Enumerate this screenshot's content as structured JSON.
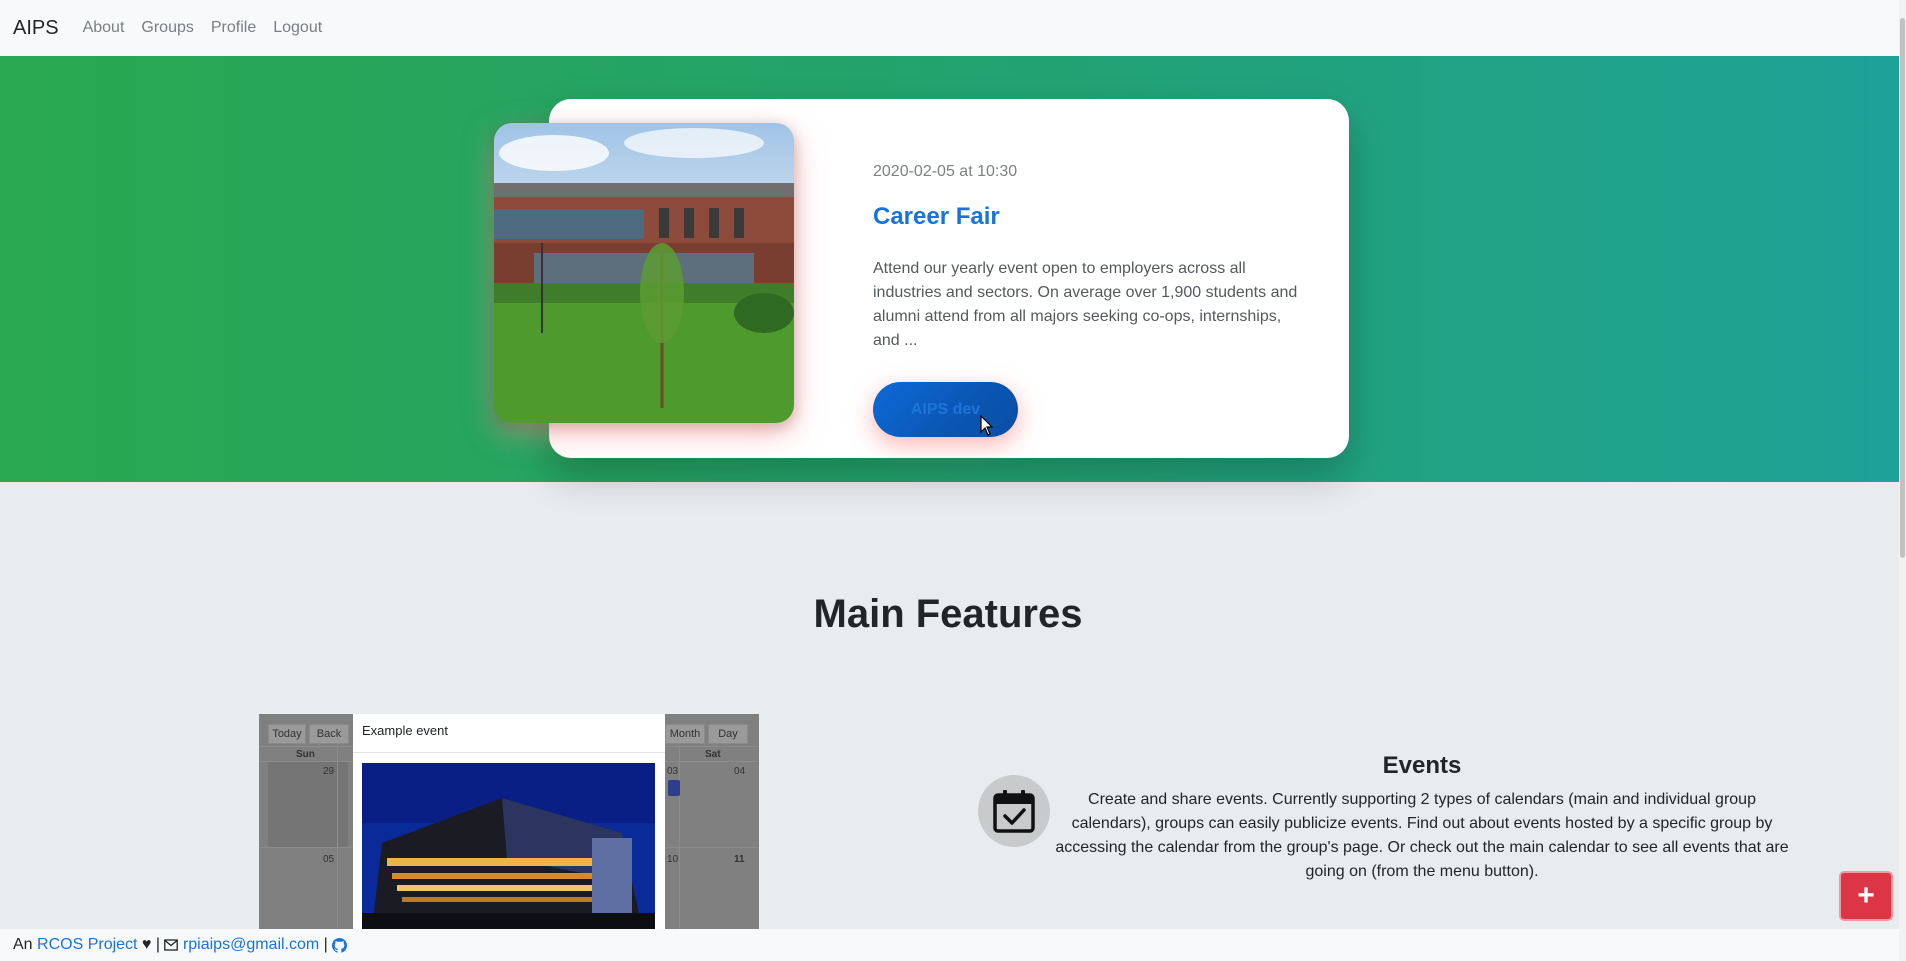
{
  "navbar": {
    "brand": "AIPS",
    "links": [
      "About",
      "Groups",
      "Profile",
      "Logout"
    ]
  },
  "hero": {
    "date": "2020-02-05 at 10:30",
    "title": "Career Fair",
    "description": "Attend our yearly event open to employers across all industries and sectors. On average over 1,900 students and alumni attend from all majors seeking co-ops, internships, and ...",
    "group_button": "AIPS dev"
  },
  "features": {
    "title": "Main Features",
    "calendar_preview": {
      "buttons": [
        "Today",
        "Back",
        "Month",
        "Day"
      ],
      "headers": [
        "Sun",
        "Sat"
      ],
      "numbers": [
        "29",
        "05",
        "03",
        "04",
        "10",
        "11"
      ],
      "modal_title": "Example event"
    },
    "events": {
      "icon": "calendar-check-icon",
      "title": "Events",
      "description": "Create and share events. Currently supporting 2 types of calendars (main and individual group calendars), groups can easily publicize events. Find out about events hosted by a specific group by accessing the calendar from the group's page. Or check out the main calendar to see all events that are going on (from the menu button)."
    }
  },
  "fab": {
    "icon": "plus-icon",
    "label": "+"
  },
  "footer": {
    "prefix": "An ",
    "project_link": "RCOS Project",
    "heart": " ♥ | ",
    "mail_icon": "mail-icon",
    "email": "rpiaips@gmail.com",
    "separator": " | ",
    "github_icon": "github-icon"
  },
  "colors": {
    "hero_start": "#29a84f",
    "hero_end": "#1ea197",
    "accent_blue": "#1a73d9",
    "fab_red": "#dc3545"
  }
}
